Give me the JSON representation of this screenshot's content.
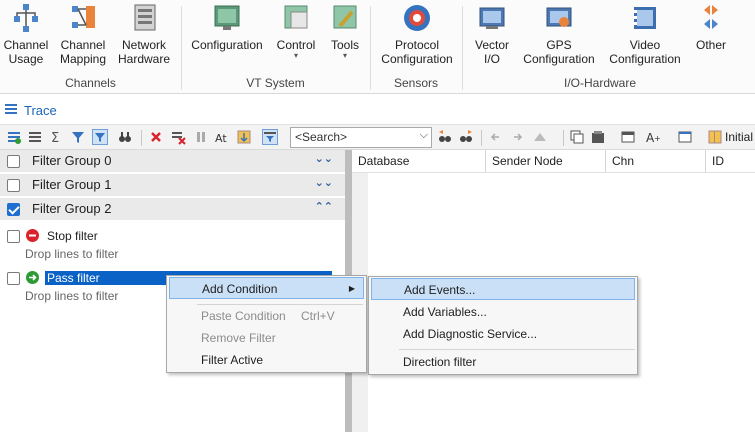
{
  "ribbon": {
    "buttons": [
      {
        "label": "Channel\nUsage",
        "icon": "channel-usage-icon"
      },
      {
        "label": "Channel\nMapping",
        "icon": "channel-mapping-icon"
      },
      {
        "label": "Network\nHardware",
        "icon": "network-hardware-icon"
      },
      {
        "label": "Configuration",
        "icon": "configuration-icon"
      },
      {
        "label": "Control",
        "icon": "control-icon"
      },
      {
        "label": "Tools",
        "icon": "tools-icon"
      },
      {
        "label": "Protocol\nConfiguration",
        "icon": "protocol-configuration-icon"
      },
      {
        "label": "Vector\nI/O",
        "icon": "vector-io-icon"
      },
      {
        "label": "GPS\nConfiguration",
        "icon": "gps-configuration-icon"
      },
      {
        "label": "Video\nConfiguration",
        "icon": "video-configuration-icon"
      },
      {
        "label": "Other",
        "icon": "other-icon"
      }
    ],
    "groups": [
      "Channels",
      "VT System",
      "Sensors",
      "I/O-Hardware"
    ]
  },
  "trace": {
    "title": "Trace"
  },
  "toolbar": {
    "search_placeholder": "<Search>",
    "initial_label": "Initial"
  },
  "filter_groups": [
    {
      "label": "Filter Group 0",
      "checked": false
    },
    {
      "label": "Filter Group 1",
      "checked": false
    },
    {
      "label": "Filter Group 2",
      "checked": true
    }
  ],
  "filters": [
    {
      "name": "Stop filter",
      "hint": "Drop lines to filter",
      "color": "#d9222a"
    },
    {
      "name": "Pass filter",
      "hint": "Drop lines to filter",
      "color": "#2e9a35"
    }
  ],
  "columns": [
    "Database",
    "Sender Node",
    "Chn",
    "ID"
  ],
  "context_menu": {
    "items": [
      {
        "label": "Add Condition",
        "highlighted": true,
        "submenu": true
      },
      {
        "label": "Paste Condition",
        "shortcut": "Ctrl+V",
        "disabled": true
      },
      {
        "label": "Remove Filter",
        "disabled": true
      },
      {
        "label": "Filter Active",
        "disabled": false
      }
    ]
  },
  "submenu": {
    "items": [
      {
        "label": "Add Events..."
      },
      {
        "label": "Add Variables..."
      },
      {
        "label": "Add Diagnostic Service..."
      },
      {
        "label": "Direction filter"
      }
    ]
  },
  "colors": {
    "accent": "#1e6fd0",
    "selection": "#0a62c6",
    "menu_highlight": "#c9e0f7"
  }
}
